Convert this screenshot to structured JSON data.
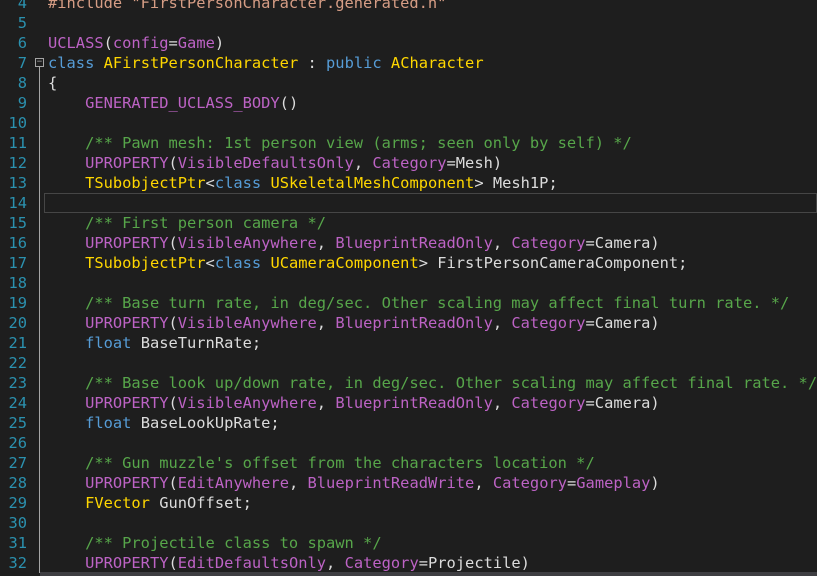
{
  "editor": {
    "lines": [
      {
        "n": "4",
        "tokens": [
          {
            "t": "#include \"FirstPersonCharacter.generated.h\"",
            "c": "str"
          }
        ]
      },
      {
        "n": "5",
        "tokens": []
      },
      {
        "n": "6",
        "tokens": [
          {
            "t": "UCLASS",
            "c": "macro"
          },
          {
            "t": "(",
            "c": "plain"
          },
          {
            "t": "config",
            "c": "macro"
          },
          {
            "t": "=",
            "c": "plain"
          },
          {
            "t": "Game",
            "c": "macro"
          },
          {
            "t": ")",
            "c": "plain"
          }
        ]
      },
      {
        "n": "7",
        "fold": "open",
        "tokens": [
          {
            "t": "class",
            "c": "kw"
          },
          {
            "t": " ",
            "c": "plain"
          },
          {
            "t": "AFirstPersonCharacter",
            "c": "class"
          },
          {
            "t": " : ",
            "c": "plain"
          },
          {
            "t": "public",
            "c": "kw"
          },
          {
            "t": " ",
            "c": "plain"
          },
          {
            "t": "ACharacter",
            "c": "class"
          }
        ]
      },
      {
        "n": "8",
        "tokens": [
          {
            "t": "{",
            "c": "plain"
          }
        ]
      },
      {
        "n": "9",
        "tokens": [
          {
            "t": "    ",
            "c": "plain"
          },
          {
            "t": "GENERATED_UCLASS_BODY",
            "c": "macro"
          },
          {
            "t": "()",
            "c": "plain"
          }
        ]
      },
      {
        "n": "10",
        "tokens": []
      },
      {
        "n": "11",
        "tokens": [
          {
            "t": "    ",
            "c": "plain"
          },
          {
            "t": "/** Pawn mesh: 1st person view (arms; seen only by self) */",
            "c": "comment"
          }
        ]
      },
      {
        "n": "12",
        "tokens": [
          {
            "t": "    ",
            "c": "plain"
          },
          {
            "t": "UPROPERTY",
            "c": "macro"
          },
          {
            "t": "(",
            "c": "plain"
          },
          {
            "t": "VisibleDefaultsOnly",
            "c": "macro"
          },
          {
            "t": ", ",
            "c": "plain"
          },
          {
            "t": "Category",
            "c": "macro"
          },
          {
            "t": "=Mesh)",
            "c": "plain"
          }
        ]
      },
      {
        "n": "13",
        "tokens": [
          {
            "t": "    ",
            "c": "plain"
          },
          {
            "t": "TSubobjectPtr",
            "c": "class"
          },
          {
            "t": "<",
            "c": "plain"
          },
          {
            "t": "class",
            "c": "kw"
          },
          {
            "t": " ",
            "c": "plain"
          },
          {
            "t": "USkeletalMeshComponent",
            "c": "class"
          },
          {
            "t": "> Mesh1P;",
            "c": "plain"
          }
        ]
      },
      {
        "n": "14",
        "current": true,
        "tokens": []
      },
      {
        "n": "15",
        "tokens": [
          {
            "t": "    ",
            "c": "plain"
          },
          {
            "t": "/** First person camera */",
            "c": "comment"
          }
        ]
      },
      {
        "n": "16",
        "tokens": [
          {
            "t": "    ",
            "c": "plain"
          },
          {
            "t": "UPROPERTY",
            "c": "macro"
          },
          {
            "t": "(",
            "c": "plain"
          },
          {
            "t": "VisibleAnywhere",
            "c": "macro"
          },
          {
            "t": ", ",
            "c": "plain"
          },
          {
            "t": "BlueprintReadOnly",
            "c": "macro"
          },
          {
            "t": ", ",
            "c": "plain"
          },
          {
            "t": "Category",
            "c": "macro"
          },
          {
            "t": "=Camera)",
            "c": "plain"
          }
        ]
      },
      {
        "n": "17",
        "tokens": [
          {
            "t": "    ",
            "c": "plain"
          },
          {
            "t": "TSubobjectPtr",
            "c": "class"
          },
          {
            "t": "<",
            "c": "plain"
          },
          {
            "t": "class",
            "c": "kw"
          },
          {
            "t": " ",
            "c": "plain"
          },
          {
            "t": "UCameraComponent",
            "c": "class"
          },
          {
            "t": "> FirstPersonCameraComponent;",
            "c": "plain"
          }
        ]
      },
      {
        "n": "18",
        "tokens": []
      },
      {
        "n": "19",
        "tokens": [
          {
            "t": "    ",
            "c": "plain"
          },
          {
            "t": "/** Base turn rate, in deg/sec. Other scaling may affect final turn rate. */",
            "c": "comment"
          }
        ]
      },
      {
        "n": "20",
        "tokens": [
          {
            "t": "    ",
            "c": "plain"
          },
          {
            "t": "UPROPERTY",
            "c": "macro"
          },
          {
            "t": "(",
            "c": "plain"
          },
          {
            "t": "VisibleAnywhere",
            "c": "macro"
          },
          {
            "t": ", ",
            "c": "plain"
          },
          {
            "t": "BlueprintReadOnly",
            "c": "macro"
          },
          {
            "t": ", ",
            "c": "plain"
          },
          {
            "t": "Category",
            "c": "macro"
          },
          {
            "t": "=Camera)",
            "c": "plain"
          }
        ]
      },
      {
        "n": "21",
        "tokens": [
          {
            "t": "    ",
            "c": "plain"
          },
          {
            "t": "float",
            "c": "kw"
          },
          {
            "t": " BaseTurnRate;",
            "c": "plain"
          }
        ]
      },
      {
        "n": "22",
        "tokens": []
      },
      {
        "n": "23",
        "tokens": [
          {
            "t": "    ",
            "c": "plain"
          },
          {
            "t": "/** Base look up/down rate, in deg/sec. Other scaling may affect final rate. */",
            "c": "comment"
          }
        ]
      },
      {
        "n": "24",
        "tokens": [
          {
            "t": "    ",
            "c": "plain"
          },
          {
            "t": "UPROPERTY",
            "c": "macro"
          },
          {
            "t": "(",
            "c": "plain"
          },
          {
            "t": "VisibleAnywhere",
            "c": "macro"
          },
          {
            "t": ", ",
            "c": "plain"
          },
          {
            "t": "BlueprintReadOnly",
            "c": "macro"
          },
          {
            "t": ", ",
            "c": "plain"
          },
          {
            "t": "Category",
            "c": "macro"
          },
          {
            "t": "=Camera)",
            "c": "plain"
          }
        ]
      },
      {
        "n": "25",
        "tokens": [
          {
            "t": "    ",
            "c": "plain"
          },
          {
            "t": "float",
            "c": "kw"
          },
          {
            "t": " BaseLookUpRate;",
            "c": "plain"
          }
        ]
      },
      {
        "n": "26",
        "tokens": []
      },
      {
        "n": "27",
        "tokens": [
          {
            "t": "    ",
            "c": "plain"
          },
          {
            "t": "/** Gun muzzle's offset from the characters location */",
            "c": "comment"
          }
        ]
      },
      {
        "n": "28",
        "tokens": [
          {
            "t": "    ",
            "c": "plain"
          },
          {
            "t": "UPROPERTY",
            "c": "macro"
          },
          {
            "t": "(",
            "c": "plain"
          },
          {
            "t": "EditAnywhere",
            "c": "macro"
          },
          {
            "t": ", ",
            "c": "plain"
          },
          {
            "t": "BlueprintReadWrite",
            "c": "macro"
          },
          {
            "t": ", ",
            "c": "plain"
          },
          {
            "t": "Category",
            "c": "macro"
          },
          {
            "t": "=",
            "c": "plain"
          },
          {
            "t": "Gameplay",
            "c": "macro"
          },
          {
            "t": ")",
            "c": "plain"
          }
        ]
      },
      {
        "n": "29",
        "tokens": [
          {
            "t": "    ",
            "c": "plain"
          },
          {
            "t": "FVector",
            "c": "class"
          },
          {
            "t": " GunOffset;",
            "c": "plain"
          }
        ]
      },
      {
        "n": "30",
        "tokens": []
      },
      {
        "n": "31",
        "tokens": [
          {
            "t": "    ",
            "c": "plain"
          },
          {
            "t": "/** Projectile class to spawn */",
            "c": "comment"
          }
        ]
      },
      {
        "n": "32",
        "tokens": [
          {
            "t": "    ",
            "c": "plain"
          },
          {
            "t": "UPROPERTY",
            "c": "macro"
          },
          {
            "t": "(",
            "c": "plain"
          },
          {
            "t": "EditDefaultsOnly",
            "c": "macro"
          },
          {
            "t": ", ",
            "c": "plain"
          },
          {
            "t": "Category",
            "c": "macro"
          },
          {
            "t": "=Projectile)",
            "c": "plain"
          }
        ]
      }
    ]
  }
}
